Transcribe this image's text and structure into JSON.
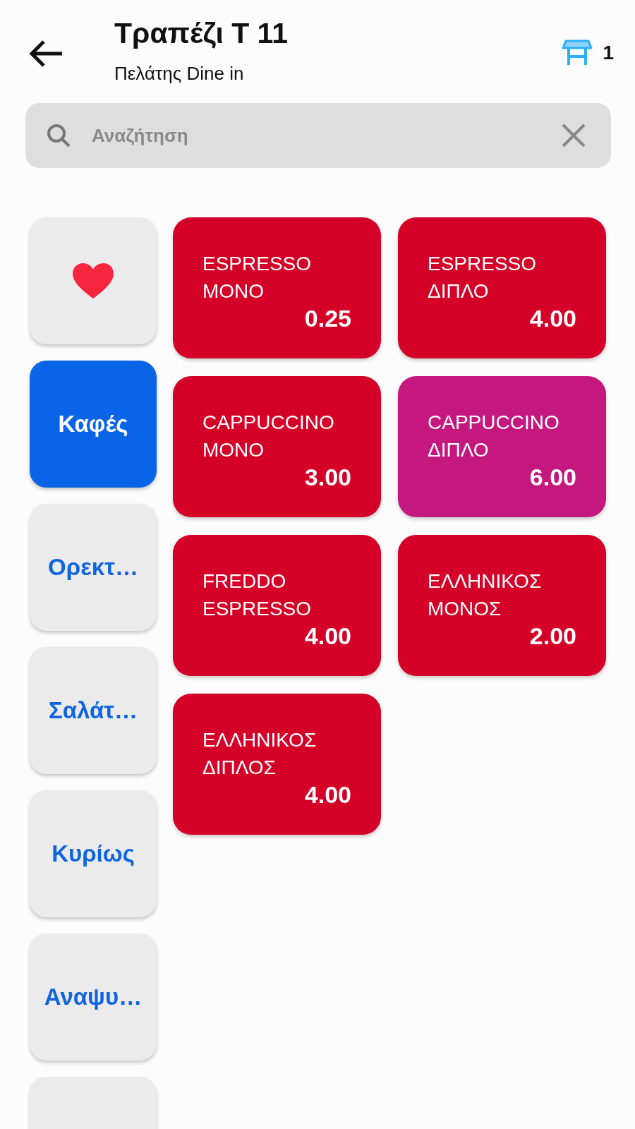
{
  "header": {
    "title": "Τραπέζι Τ 11",
    "subtitle": "Πελάτης Dine in",
    "table_count": "1"
  },
  "search": {
    "placeholder": "Αναζήτηση"
  },
  "categories": [
    {
      "kind": "favorites",
      "selected": false
    },
    {
      "kind": "label",
      "label": "Καφές",
      "selected": true
    },
    {
      "kind": "label",
      "label": "Ορεκτ…",
      "selected": false
    },
    {
      "kind": "label",
      "label": "Σαλάτ…",
      "selected": false
    },
    {
      "kind": "label",
      "label": "Κυρίως",
      "selected": false
    },
    {
      "kind": "label",
      "label": "Αναψυ…",
      "selected": false
    },
    {
      "kind": "blank",
      "selected": false
    }
  ],
  "products": [
    {
      "name": "ESPRESSO ΜΟΝΟ",
      "price": "0.25",
      "color": "#d50027"
    },
    {
      "name": "ESPRESSO ΔΙΠΛΟ",
      "price": "4.00",
      "color": "#d50027"
    },
    {
      "name": "CAPPUCCINO ΜΟΝΟ",
      "price": "3.00",
      "color": "#d50027"
    },
    {
      "name": "CAPPUCCINO ΔΙΠΛΟ",
      "price": "6.00",
      "color": "#c4187f"
    },
    {
      "name": "FREDDO ESPRESSO",
      "price": "4.00",
      "color": "#d50027"
    },
    {
      "name": "ΕΛΛΗΝΙΚΟΣ ΜΟΝΟΣ",
      "price": "2.00",
      "color": "#d50027"
    },
    {
      "name": "ΕΛΛΗΝΙΚΟΣ ΔΙΠΛΟΣ",
      "price": "4.00",
      "color": "#d50027"
    }
  ]
}
